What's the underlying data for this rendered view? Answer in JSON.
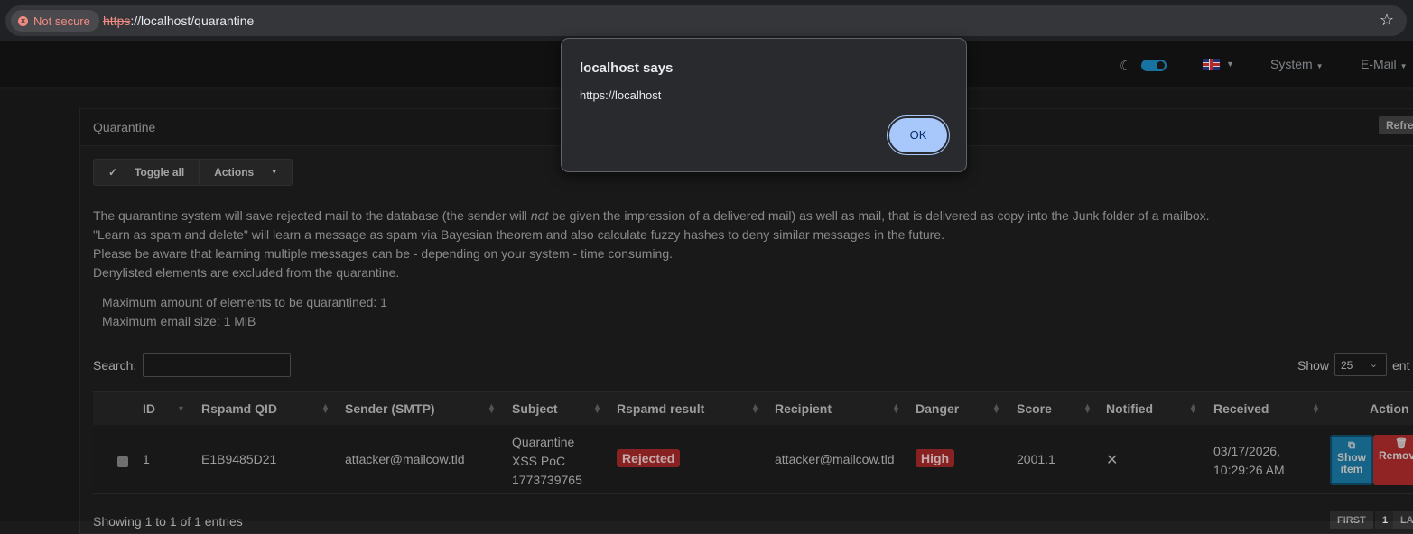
{
  "browser": {
    "security_chip": "Not secure",
    "url_scheme": "https",
    "url_rest": "://localhost/quarantine",
    "bookmark_icon": "star-icon"
  },
  "navbar": {
    "theme_icon": "moon-icon",
    "language_icon": "uk-flag-icon",
    "system_label": "System",
    "email_label": "E-Mail"
  },
  "panel": {
    "title": "Quarantine",
    "refresh_label": "Refre",
    "toggle_all_label": "Toggle all",
    "actions_label": "Actions",
    "info": {
      "line1_before": "The quarantine system will save rejected mail to the database (the sender will ",
      "line1_em": "not",
      "line1_after": " be given the impression of a delivered mail) as well as mail, that is delivered as copy into the Junk folder of a mailbox.",
      "line2": "\"Learn as spam and delete\" will learn a message as spam via Bayesian theorem and also calculate fuzzy hashes to deny similar messages in the future.",
      "line3": "Please be aware that learning multiple messages can be - depending on your system - time consuming.",
      "line4": "Denylisted elements are excluded from the quarantine."
    },
    "limits": {
      "max_elements": "Maximum amount of elements to be quarantined: 1",
      "max_size": "Maximum email size: 1 MiB"
    },
    "search_label": "Search:",
    "search_value": "",
    "show_label": "Show",
    "show_value": "25",
    "entries_label": "ent"
  },
  "table": {
    "headers": {
      "id": "ID",
      "qid": "Rspamd QID",
      "sender": "Sender (SMTP)",
      "subject": "Subject",
      "result": "Rspamd result",
      "recipient": "Recipient",
      "danger": "Danger",
      "score": "Score",
      "notified": "Notified",
      "received": "Received",
      "action": "Action"
    },
    "rows": [
      {
        "id": "1",
        "qid": "E1B9485D21",
        "sender": "attacker@mailcow.tld",
        "subject_l1": "Quarantine",
        "subject_l2": "XSS PoC",
        "subject_l3": "1773739765",
        "result": "Rejected",
        "recipient": "attacker@mailcow.tld",
        "danger": "High",
        "score": "2001.1",
        "notified": "✕",
        "received_l1": "03/17/2026,",
        "received_l2": "10:29:26 AM",
        "show_l1": "Show",
        "show_l2": "item",
        "remove": "Remov"
      }
    ],
    "footer": "Showing 1 to 1 of 1 entries",
    "pagination": {
      "first": "FIRST",
      "page": "1",
      "last": "LA"
    }
  },
  "dialog": {
    "title": "localhost says",
    "message": "https://localhost",
    "ok_label": "OK"
  }
}
